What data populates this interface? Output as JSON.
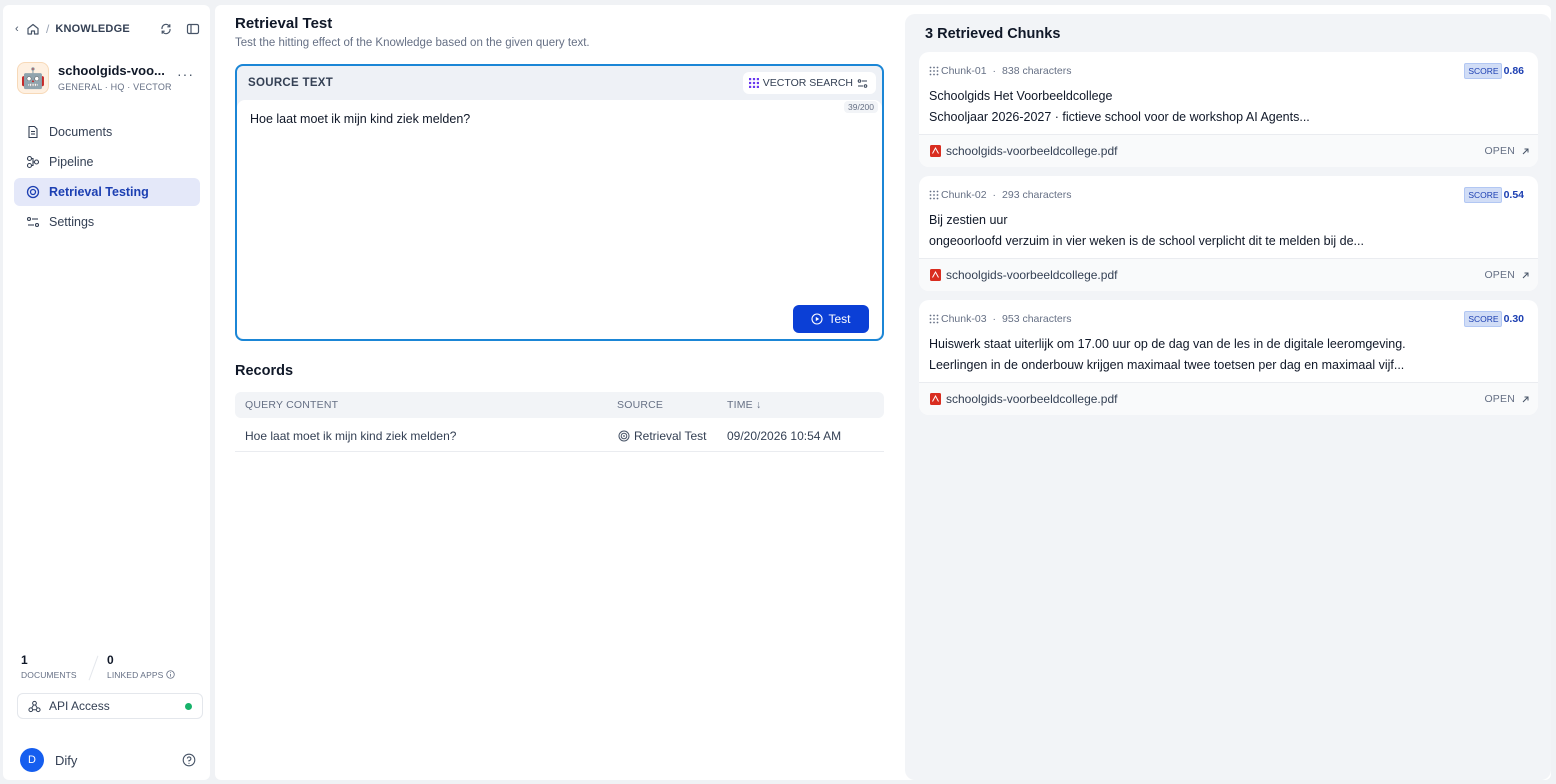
{
  "breadcrumb": {
    "section": "KNOWLEDGE"
  },
  "knowledge": {
    "name": "schoolgids-voo...",
    "meta": "GENERAL · HQ · VECTOR",
    "avatar": "🤖"
  },
  "nav": [
    {
      "label": "Documents",
      "icon": "document-icon"
    },
    {
      "label": "Pipeline",
      "icon": "pipeline-icon"
    },
    {
      "label": "Retrieval Testing",
      "icon": "target-icon",
      "active": true
    },
    {
      "label": "Settings",
      "icon": "settings-icon"
    }
  ],
  "stats": {
    "documents": {
      "value": "1",
      "label": "DOCUMENTS"
    },
    "linked_apps": {
      "value": "0",
      "label": "LINKED APPS"
    }
  },
  "api": {
    "label": "API Access",
    "status_color": "#17b26a"
  },
  "user": {
    "initial": "D",
    "name": "Dify"
  },
  "main": {
    "title": "Retrieval Test",
    "description": "Test the hitting effect of the Knowledge based on the given query text.",
    "source": {
      "title": "SOURCE TEXT",
      "search_mode": "VECTOR SEARCH",
      "counter": "39/200",
      "query": "Hoe laat moet ik mijn kind ziek melden?",
      "test_label": "Test"
    },
    "records": {
      "title": "Records",
      "columns": {
        "query": "QUERY CONTENT",
        "source": "SOURCE",
        "time": "TIME ↓"
      },
      "rows": [
        {
          "query": "Hoe laat moet ik mijn kind ziek melden?",
          "source": "Retrieval Test",
          "time": "09/20/2026 10:54 AM"
        }
      ]
    }
  },
  "results": {
    "title": "3 Retrieved Chunks",
    "chunks": [
      {
        "id": "Chunk-01",
        "chars": "838 characters",
        "score_label": "SCORE",
        "score": "0.86",
        "line1": "Schoolgids Het Voorbeeldcollege",
        "line2": "Schooljaar 2026-2027 · fictieve school voor de workshop AI Agents...",
        "file": "schoolgids-voorbeeldcollege.pdf",
        "open": "OPEN"
      },
      {
        "id": "Chunk-02",
        "chars": "293 characters",
        "score_label": "SCORE",
        "score": "0.54",
        "line1": "Bij zestien uur",
        "line2": "ongeoorloofd verzuim in vier weken is de school verplicht dit te melden bij de...",
        "file": "schoolgids-voorbeeldcollege.pdf",
        "open": "OPEN"
      },
      {
        "id": "Chunk-03",
        "chars": "953 characters",
        "score_label": "SCORE",
        "score": "0.30",
        "line1": "Huiswerk staat uiterlijk om 17.00 uur op de dag van de les in de digitale leeromgeving.",
        "line2": "Leerlingen in de onderbouw krijgen maximaal twee toetsen per dag en maximaal vijf...",
        "file": "schoolgids-voorbeeldcollege.pdf",
        "open": "OPEN"
      }
    ]
  }
}
